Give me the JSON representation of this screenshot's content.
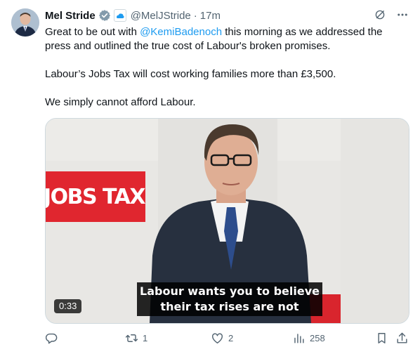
{
  "author": {
    "name": "Mel Stride",
    "handle": "@MelJStride",
    "time_sep": "·",
    "time": "17m"
  },
  "body": {
    "line1_pre": "Great to be out with ",
    "mention": "@KemiBadenoch",
    "line1_post": " this morning as we addressed the press and outlined the true cost of Labour's broken promises.",
    "para2": "Labour’s Jobs Tax will cost working families more than £3,500.",
    "para3": "We simply cannot afford Labour."
  },
  "media": {
    "sign_text": "JOBS TAX",
    "caption_line1": "Labour wants you to believe",
    "caption_line2": "their tax rises are not",
    "duration": "0:33"
  },
  "actions": {
    "reply_count": "",
    "retweet_count": "1",
    "like_count": "2",
    "views_count": "258"
  },
  "colors": {
    "accent": "#1d9bf0",
    "muted": "#536471",
    "sign_red": "#e0262f",
    "badge_gray": "#829aab"
  },
  "icons": [
    "verified-badge-icon",
    "affiliate-icon",
    "grok-icon",
    "more-icon",
    "reply-icon",
    "retweet-icon",
    "like-icon",
    "views-icon",
    "bookmark-icon",
    "share-icon"
  ]
}
